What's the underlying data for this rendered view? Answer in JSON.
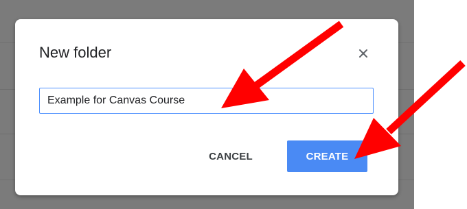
{
  "dialog": {
    "title": "New folder",
    "close_icon": "close-icon",
    "folder_name_value": "Example for Canvas Course",
    "cancel_label": "CANCEL",
    "create_label": "CREATE"
  },
  "colors": {
    "overlay": "#7b7b7b",
    "accent": "#4a8af4",
    "annotation_arrow": "#ff0000"
  }
}
